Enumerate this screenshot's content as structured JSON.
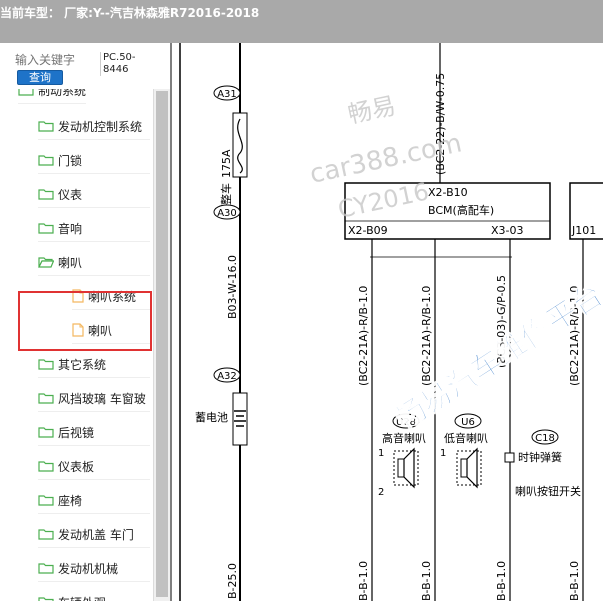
{
  "header": {
    "title": "当前车型：  厂家:Y--汽吉林森雅R72016-2018"
  },
  "search": {
    "placeholder": "输入关键字",
    "button_label": "查询",
    "code": "PC.50-8446"
  },
  "tree": {
    "partial_item": "制动系统",
    "items": [
      {
        "label": "发动机控制系统",
        "type": "folder"
      },
      {
        "label": "门锁",
        "type": "folder"
      },
      {
        "label": "仪表",
        "type": "folder"
      },
      {
        "label": "音响",
        "type": "folder"
      },
      {
        "label": "喇叭",
        "type": "folder-open"
      },
      {
        "label": "喇叭系统",
        "type": "file"
      },
      {
        "label": "喇叭",
        "type": "file"
      },
      {
        "label": "其它系统",
        "type": "folder"
      },
      {
        "label": "风挡玻璃 车窗玻",
        "type": "folder"
      },
      {
        "label": "后视镜",
        "type": "folder"
      },
      {
        "label": "仪表板",
        "type": "folder"
      },
      {
        "label": "座椅",
        "type": "folder"
      },
      {
        "label": "发动机盖 车门",
        "type": "folder"
      },
      {
        "label": "发动机机械",
        "type": "folder"
      },
      {
        "label": "车辆外观",
        "type": "folder"
      }
    ]
  },
  "diagram": {
    "connectors": {
      "a31": "A31",
      "a30": "A30",
      "a32": "A32",
      "u28": "U28",
      "u6": "U6",
      "c18": "C18"
    },
    "fuse_label": "175A",
    "fuse_name": "整车",
    "battery_label": "蓄电池",
    "wire_top": "(BC2-22)-B/W-0.75",
    "wire_main": "B03-W-16.0",
    "wire_bottom": "B-25.0",
    "bcm_pin_top": "X2-B10",
    "bcm_name": "BCM(高配车)",
    "bcm_pin_left": "X2-B09",
    "bcm_pin_right": "X3-03",
    "right_module_pin": "J101",
    "wire_v1": "(BC2-21A)-R/B-1.0",
    "wire_v2": "(BC2-21A)-R/B-1.0",
    "wire_v3": "(BC3-03)-G/P-0.5",
    "wire_v4": "(BC2-21A)-R/B-1.0",
    "horn_high": "高音喇叭",
    "horn_low": "低音喇叭",
    "clock_spring": "时钟弹簧",
    "horn_switch": "喇叭按钮开关",
    "pin1": "1",
    "pin2": "2",
    "bottom_w1": "B-B-1.0",
    "bottom_w2": "B-B-1.0",
    "bottom_w3": "B-B-1.0",
    "bottom_w4": "B-B-1.0"
  },
  "watermark": {
    "line1": "畅易",
    "line2": "car388.com",
    "line3": "CY2016",
    "banner": "畅易汽车维修平台"
  },
  "colors": {
    "topbar": "#a9a9a9",
    "accent": "#1e73c8",
    "highlight": "#e03232",
    "folder": "#4caf50",
    "file": "#f4b860",
    "watermark_gray": "#c8c8c8",
    "banner_blue": "#1565c0"
  }
}
